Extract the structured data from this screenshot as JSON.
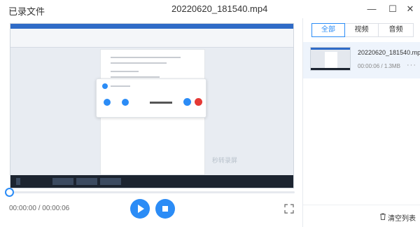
{
  "app": {
    "title": "已录文件",
    "file_name": "20220620_181540.mp4"
  },
  "window": {
    "minimize": "—",
    "maximize": "☐",
    "close": "✕"
  },
  "player": {
    "current_time": "00:00:00",
    "separator": " / ",
    "total_time": "00:00:06",
    "progress_fraction": 0,
    "watermark": "秒转录屏"
  },
  "panel": {
    "tabs": [
      {
        "label": "全部",
        "active": true
      },
      {
        "label": "视频",
        "active": false
      },
      {
        "label": "音频",
        "active": false
      }
    ],
    "files": [
      {
        "name": "20220620_181540.mp4",
        "duration": "00:00:06",
        "size": "1.3MB",
        "more": "···"
      }
    ],
    "clear_list": "清空列表"
  },
  "colors": {
    "accent": "#2b8cf6",
    "selected_bg": "#eef4fc"
  }
}
